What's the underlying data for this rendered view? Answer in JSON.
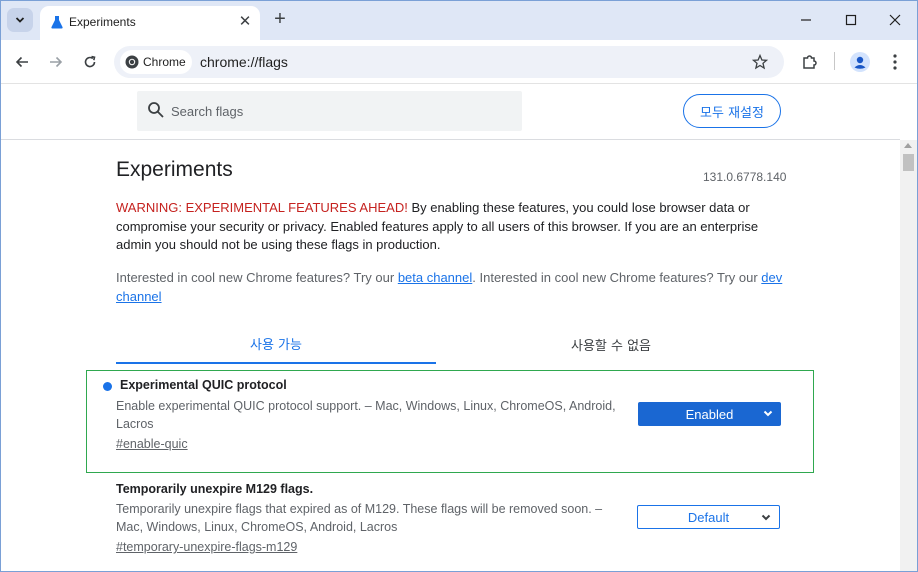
{
  "browser": {
    "tab_title": "Experiments",
    "omnibox_chip": "Chrome",
    "url": "chrome://flags"
  },
  "flags_page": {
    "search_placeholder": "Search flags",
    "reset_all_label": "모두 재설정",
    "title": "Experiments",
    "version": "131.0.6778.140",
    "warning_heading": "WARNING: EXPERIMENTAL FEATURES AHEAD!",
    "warning_body": " By enabling these features, you could lose browser data or compromise your security or privacy. Enabled features apply to all users of this browser. If you are an enterprise admin you should not be using these flags in production.",
    "interest_text_1": "Interested in cool new Chrome features? Try our ",
    "beta_link": "beta channel",
    "interest_text_2": ". Interested in cool new Chrome features? Try our ",
    "dev_link": "dev channel",
    "tabs": [
      {
        "label": "사용 가능"
      },
      {
        "label": "사용할 수 없음"
      }
    ],
    "flags": [
      {
        "name": "Experimental QUIC protocol",
        "description": "Enable experimental QUIC protocol support. – Mac, Windows, Linux, ChromeOS, Android, Lacros",
        "link": "#enable-quic",
        "state": "Enabled"
      },
      {
        "name": "Temporarily unexpire M129 flags.",
        "description": "Temporarily unexpire flags that expired as of M129. These flags will be removed soon. – Mac, Windows, Linux, ChromeOS, Android, Lacros",
        "link": "#temporary-unexpire-flags-m129",
        "state": "Default"
      }
    ]
  },
  "colors": {
    "accent": "#1a73e8",
    "warning": "#c5221f",
    "tabstrip": "#dfe7f6",
    "highlight_border": "#2fa84f"
  }
}
